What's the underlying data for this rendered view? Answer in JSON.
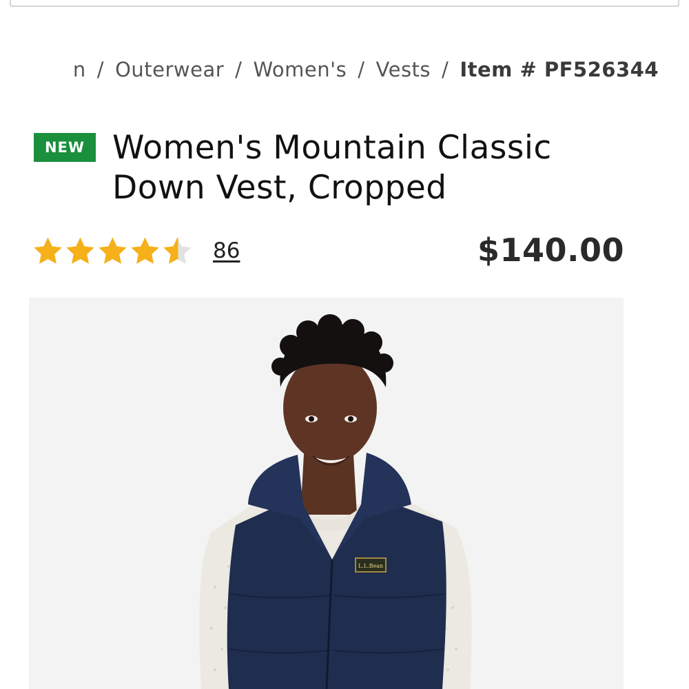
{
  "breadcrumb": {
    "items": [
      "n",
      "Outerwear",
      "Women's",
      "Vests"
    ],
    "separator": "/",
    "current": "Item # PF526344"
  },
  "product": {
    "badge": "NEW",
    "title_line1": "Women's Mountain Classic",
    "title_line2": "Down Vest, Cropped",
    "rating": 4.5,
    "rating_max": 5,
    "review_count": "86",
    "price": "$140.00",
    "logo_text": "L.L.Bean"
  },
  "colors": {
    "badge": "#1a8f3c",
    "star": "#f5b01a",
    "star_empty": "#e2e2e2",
    "vest": "#1f2d4f"
  }
}
